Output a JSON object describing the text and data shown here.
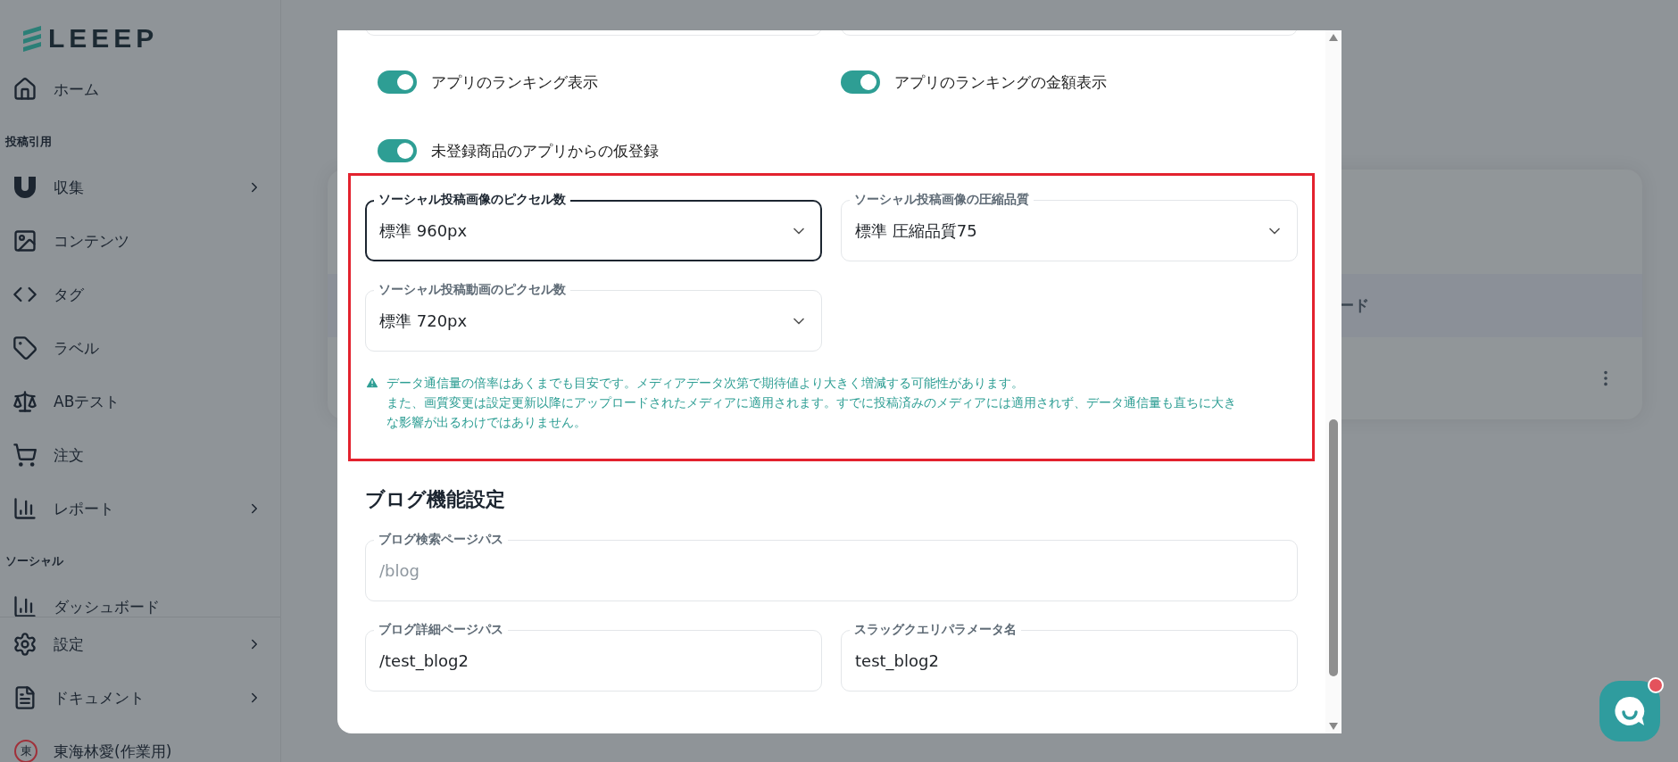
{
  "sidebar": {
    "logo": "LEEEP",
    "nav": [
      {
        "kind": "item",
        "label": "ホーム",
        "submenu": false
      },
      {
        "kind": "heading",
        "label": "投稿引用"
      },
      {
        "kind": "item",
        "label": "収集",
        "submenu": true
      },
      {
        "kind": "item",
        "label": "コンテンツ",
        "submenu": false
      },
      {
        "kind": "item",
        "label": "タグ",
        "submenu": false
      },
      {
        "kind": "item",
        "label": "ラベル",
        "submenu": false
      },
      {
        "kind": "item",
        "label": "ABテスト",
        "submenu": false
      },
      {
        "kind": "item",
        "label": "注文",
        "submenu": false
      },
      {
        "kind": "item",
        "label": "レポート",
        "submenu": true
      },
      {
        "kind": "heading",
        "label": "ソーシャル"
      },
      {
        "kind": "item",
        "label": "ダッシュボード",
        "submenu": false
      }
    ],
    "footer": [
      {
        "kind": "item",
        "label": "設定",
        "submenu": true
      },
      {
        "kind": "item",
        "label": "ドキュメント",
        "submenu": true
      },
      {
        "kind": "user",
        "avatar": "東",
        "label": "東海林愛(作業用)"
      }
    ]
  },
  "background": {
    "table_header_fragment": "ード"
  },
  "modal": {
    "toggles": [
      {
        "label": "アプリのランキング表示",
        "on": true
      },
      {
        "label": "アプリのランキングの金額表示",
        "on": true
      },
      {
        "label": "未登録商品のアプリからの仮登録",
        "on": true
      }
    ],
    "highlighted_section": {
      "selects": [
        {
          "label": "ソーシャル投稿画像のピクセル数",
          "value": "標準 960px",
          "focused": true
        },
        {
          "label": "ソーシャル投稿画像の圧縮品質",
          "value": "標準 圧縮品質75",
          "focused": false
        },
        {
          "label": "ソーシャル投稿動画のピクセル数",
          "value": "標準 720px",
          "focused": false
        }
      ],
      "warning": [
        "データ通信量の倍率はあくまでも目安です。メディアデータ次第で期待値より大きく増減する可能性があります。",
        "また、画質変更は設定更新以降にアップロードされたメディアに適用されます。すでに投稿済みのメディアには適用されず、データ通信量も直ちに大きな影響が出るわけではありません。"
      ]
    },
    "blog": {
      "title": "ブログ機能設定",
      "rows": [
        [
          {
            "label": "ブログ検索ページパス",
            "placeholder": "/blog"
          }
        ],
        [
          {
            "label": "ブログ詳細ページパス",
            "value": "/test_blog2"
          },
          {
            "label": "スラッグクエリパラメータ名",
            "value": "test_blog2"
          }
        ]
      ]
    }
  },
  "chat": {
    "unread": true
  }
}
